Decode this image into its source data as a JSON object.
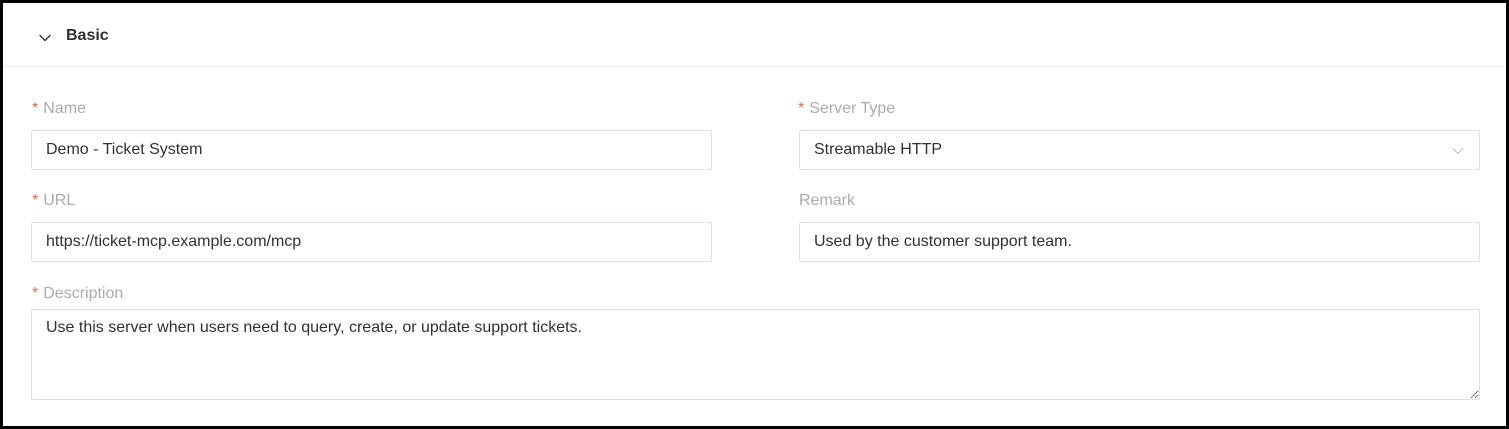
{
  "section": {
    "title": "Basic",
    "expanded": true
  },
  "form": {
    "required_mark": "*",
    "name": {
      "label": "Name",
      "required": true,
      "value": "Demo - Ticket System"
    },
    "server_type": {
      "label": "Server Type",
      "required": true,
      "value": "Streamable HTTP"
    },
    "url": {
      "label": "URL",
      "required": true,
      "value": "https://ticket-mcp.example.com/mcp"
    },
    "remark": {
      "label": "Remark",
      "required": false,
      "value": "Used by the customer support team."
    },
    "description": {
      "label": "Description",
      "required": true,
      "value": "Use this server when users need to query, create, or update support tickets."
    }
  },
  "colors": {
    "required": "#e06c5a",
    "label": "#a8abb2",
    "text": "#303133",
    "border": "#dcdfe6"
  },
  "icons": {
    "collapse": "chevron-down-icon",
    "select_arrow": "chevron-down-icon"
  }
}
